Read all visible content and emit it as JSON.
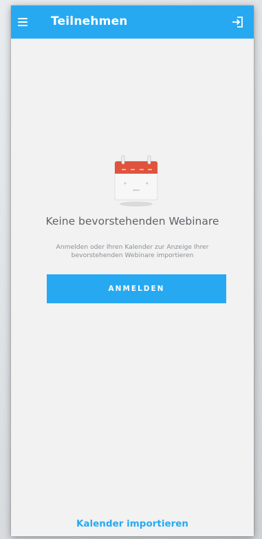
{
  "appbar": {
    "title": "Teilnehmen",
    "menu_icon": "hamburger-menu-icon",
    "signin_icon": "login-arrow-icon",
    "color": "#27a9f2"
  },
  "empty_state": {
    "illustration": "calendar-icon",
    "title": "Keine bevorstehenden Webinare",
    "subtitle": "Anmelden oder Ihren Kalender zur Anzeige Ihrer bevorstehenden Webinare importieren"
  },
  "actions": {
    "anmelden_label": "ANMELDEN",
    "import_calendar_label": "Kalender importieren"
  }
}
